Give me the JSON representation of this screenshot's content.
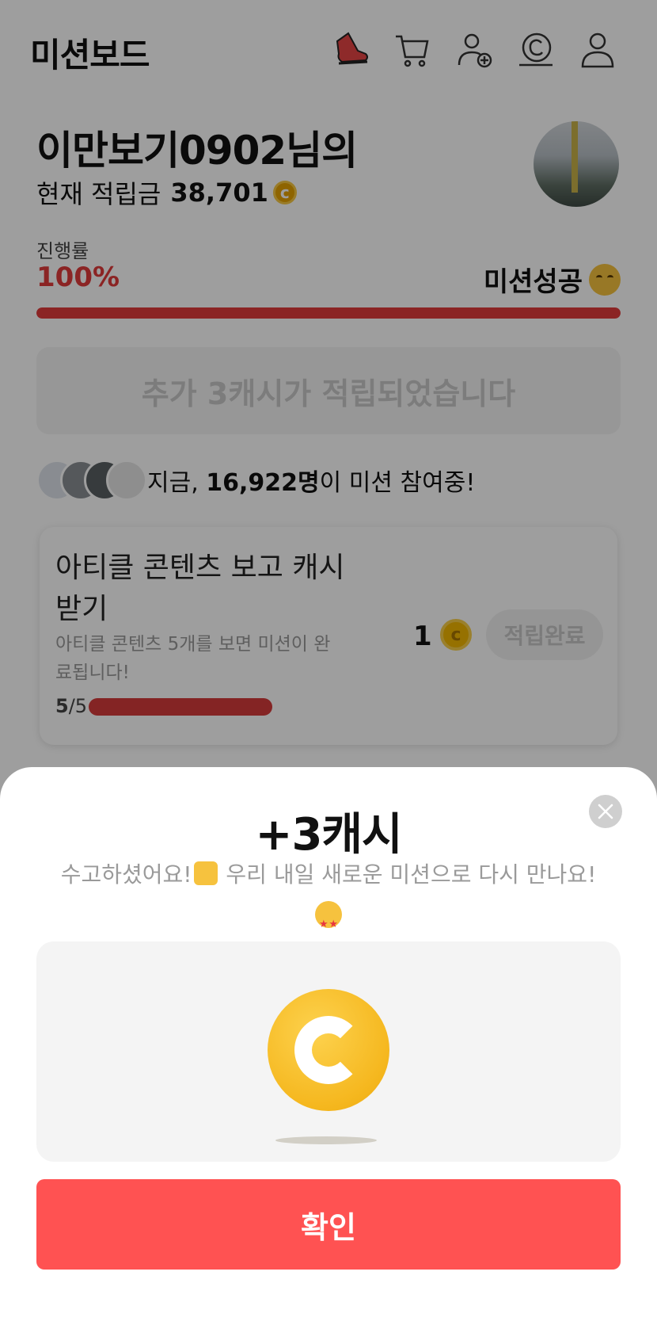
{
  "header": {
    "title": "미션보드",
    "icons": [
      "shoe-icon",
      "cart-icon",
      "add-user-icon",
      "coin-outline-icon",
      "user-icon"
    ]
  },
  "profile": {
    "name": "이만보기0902님의",
    "balance_label": "현재 적립금",
    "balance_value": "38,701"
  },
  "progress": {
    "label": "진행률",
    "value_text": "100%",
    "fraction": 1.0,
    "status_text": "미션성공"
  },
  "extra_banner": "추가 3캐시가 적립되었습니다",
  "participants": {
    "prefix": "지금, ",
    "count": "16,922명",
    "suffix": "이 미션 참여중!"
  },
  "mission": {
    "title": "아티클 콘텐츠 보고 캐시 받기",
    "description": "아티클 콘텐츠 5개를 보면 미션이 완료됩니다!",
    "progress_done": "5",
    "progress_total": "/5",
    "reward": "1",
    "status": "적립완료"
  },
  "sheet": {
    "title": "+3캐시",
    "message_part1": "수고하셨어요!",
    "message_part2": " 우리 내일 새로운 미션으로 다시 만나요!",
    "confirm_label": "확인"
  },
  "colors": {
    "accent_red": "#ff5252",
    "progress_red": "#e03a3a",
    "coin_gold": "#f5b71e"
  }
}
